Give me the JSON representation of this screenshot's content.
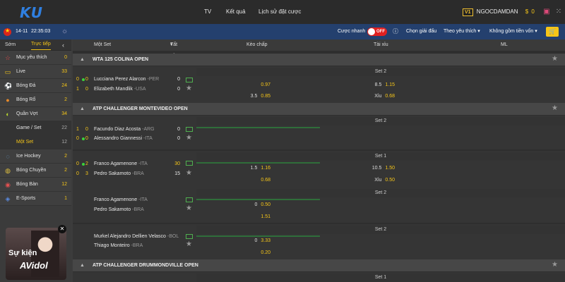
{
  "logo": "KU",
  "nav": {
    "tv": "TV",
    "results": "Kết quả",
    "history": "Lịch sử đặt cược"
  },
  "user": {
    "level": "V1",
    "name": "NGOCDAMDAN",
    "currency": "$",
    "balance": "0"
  },
  "bar": {
    "date": "14-11",
    "time": "22:35:03",
    "quick_bet": "Cược nhanh",
    "toggle": "OFF",
    "choose_league": "Chọn giải đấu",
    "sort": "Theo yêu thích",
    "no_capital": "Không gồm tiền vốn"
  },
  "sidebar": {
    "tab_early": "Sớm",
    "tab_live": "Trực tiếp",
    "items": [
      {
        "label": "Mục yêu thích",
        "count": "0",
        "icon": "star-icon"
      },
      {
        "label": "Live",
        "count": "33",
        "icon": "tv-icon"
      },
      {
        "label": "Bóng Đá",
        "count": "24",
        "icon": "soccer-icon"
      },
      {
        "label": "Bóng Rổ",
        "count": "2",
        "icon": "basketball-icon"
      },
      {
        "label": "Quần Vợt",
        "count": "34",
        "icon": "tennis-icon"
      },
      {
        "label": "Game / Set",
        "count": "22"
      },
      {
        "label": "Một Set",
        "count": "12"
      },
      {
        "label": "Ice Hockey",
        "count": "2",
        "icon": "hockey-icon"
      },
      {
        "label": "Bóng Chuyền",
        "count": "2",
        "icon": "volleyball-icon"
      },
      {
        "label": "Bóng Bàn",
        "count": "12",
        "icon": "pingpong-icon"
      },
      {
        "label": "E-Sports",
        "count": "1",
        "icon": "esports-icon"
      }
    ]
  },
  "promo": {
    "line1": "Sự kiện",
    "line2": "AVidol"
  },
  "header": {
    "market": "Một Set",
    "all": "Tất cả",
    "handicap": "Kèo chấp",
    "overunder": "Tài xỉu",
    "ml": "ML"
  },
  "leagues": [
    {
      "name": "WTA 125 COLINA OPEN"
    },
    {
      "name": "ATP CHALLENGER MONTEVIDEO OPEN"
    },
    {
      "name": "ATP CHALLENGER DRUMMONDVILLE OPEN"
    }
  ],
  "matches": [
    {
      "set": "Set 2",
      "t1": {
        "s1": "0",
        "s2": "0",
        "name": "Lucciana Perez Alarcon",
        "ct": "-PER",
        "pts": "0"
      },
      "t2": {
        "s1": "1",
        "s2": "0",
        "name": "Elizabeth Mandlik",
        "ct": "-USA",
        "pts": "0"
      },
      "h1": {
        "k": "",
        "v": "0.97"
      },
      "h2": {
        "k": "3.5",
        "v": "0.85"
      },
      "o1": {
        "k": "8.5",
        "v": "1.15"
      },
      "o2": {
        "k": "Xỉu",
        "v": "0.68"
      }
    },
    {
      "set": "Set 2",
      "t1": {
        "s1": "1",
        "s2": "0",
        "name": "Facundo Diaz Acosta",
        "ct": "-ARG",
        "pts": "0"
      },
      "t2": {
        "s1": "0",
        "s2": "0",
        "name": "Alessandro Giannessi",
        "ct": "-ITA",
        "pts": "0"
      }
    },
    {
      "set": "Set 1",
      "t1": {
        "s1": "0",
        "s2": "2",
        "name": "Franco Agamenone",
        "ct": "-ITA",
        "pts": "30"
      },
      "t2": {
        "s1": "0",
        "s2": "3",
        "name": "Pedro Sakamoto",
        "ct": "-BRA",
        "pts": "15"
      },
      "h1": {
        "k": "1.5",
        "v": "1.16"
      },
      "h2": {
        "k": "",
        "v": "0.68"
      },
      "o1": {
        "k": "10.5",
        "v": "1.50"
      },
      "o2": {
        "k": "Xỉu",
        "v": "0.50"
      }
    },
    {
      "set": "Set 2",
      "t1": {
        "name": "Franco Agamenone",
        "ct": "-ITA"
      },
      "t2": {
        "name": "Pedro Sakamoto",
        "ct": "-BRA"
      },
      "h1": {
        "k": "0",
        "v": "0.50"
      },
      "h2": {
        "k": "",
        "v": "1.51"
      }
    },
    {
      "set": "Set 2",
      "t1": {
        "name": "Murkel Alejandro Dellien Velasco",
        "ct": "-BOL"
      },
      "t2": {
        "name": "Thiago Monteiro",
        "ct": "-BRA"
      },
      "h1": {
        "k": "0",
        "v": "3.33"
      },
      "h2": {
        "k": "",
        "v": "0.20"
      }
    },
    {
      "set": "Set 1"
    }
  ],
  "colors": {
    "accent": "#f5c518",
    "bar": "#24406e",
    "toggle": "#e02020"
  }
}
